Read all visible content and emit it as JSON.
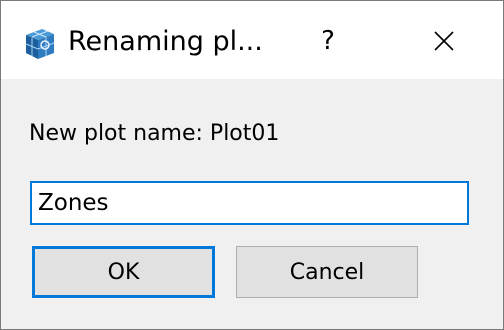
{
  "window": {
    "title": "Renaming pl...",
    "help_label": "?",
    "icons": {
      "app": "plot-cube-icon",
      "close": "close-icon"
    }
  },
  "dialog": {
    "prompt": "New plot name: Plot01",
    "name_value": "Zones",
    "ok_label": "OK",
    "cancel_label": "Cancel"
  },
  "colors": {
    "accent": "#0078d7",
    "background": "#f0f0f0",
    "titlebar": "#ffffff",
    "button": "#e1e1e1"
  }
}
